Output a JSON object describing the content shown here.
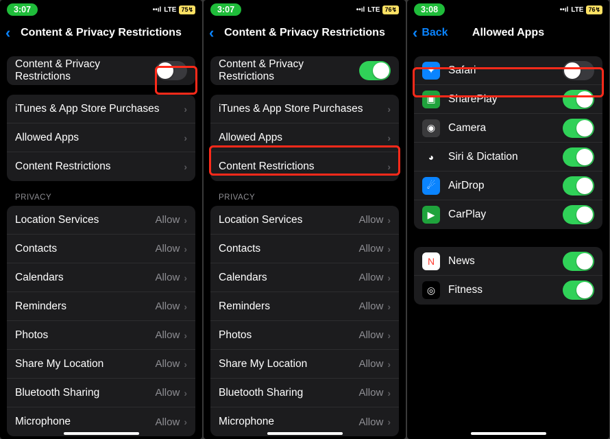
{
  "phones": [
    {
      "time": "3:07",
      "signal": "••ıl",
      "network": "LTE",
      "battery": "75",
      "title": "Content & Privacy Restrictions",
      "toggleRow": {
        "label": "Content & Privacy Restrictions",
        "on": false
      },
      "navRows": [
        {
          "label": "iTunes & App Store Purchases"
        },
        {
          "label": "Allowed Apps"
        },
        {
          "label": "Content Restrictions"
        }
      ],
      "privacyHeader": "PRIVACY",
      "privacyRows": [
        {
          "label": "Location Services",
          "value": "Allow"
        },
        {
          "label": "Contacts",
          "value": "Allow"
        },
        {
          "label": "Calendars",
          "value": "Allow"
        },
        {
          "label": "Reminders",
          "value": "Allow"
        },
        {
          "label": "Photos",
          "value": "Allow"
        },
        {
          "label": "Share My Location",
          "value": "Allow"
        },
        {
          "label": "Bluetooth Sharing",
          "value": "Allow"
        },
        {
          "label": "Microphone",
          "value": "Allow"
        }
      ]
    },
    {
      "time": "3:07",
      "signal": "••ıl",
      "network": "LTE",
      "battery": "76",
      "title": "Content & Privacy Restrictions",
      "toggleRow": {
        "label": "Content & Privacy Restrictions",
        "on": true
      },
      "navRows": [
        {
          "label": "iTunes & App Store Purchases"
        },
        {
          "label": "Allowed Apps"
        },
        {
          "label": "Content Restrictions"
        }
      ],
      "privacyHeader": "PRIVACY",
      "privacyRows": [
        {
          "label": "Location Services",
          "value": "Allow"
        },
        {
          "label": "Contacts",
          "value": "Allow"
        },
        {
          "label": "Calendars",
          "value": "Allow"
        },
        {
          "label": "Reminders",
          "value": "Allow"
        },
        {
          "label": "Photos",
          "value": "Allow"
        },
        {
          "label": "Share My Location",
          "value": "Allow"
        },
        {
          "label": "Bluetooth Sharing",
          "value": "Allow"
        },
        {
          "label": "Microphone",
          "value": "Allow"
        }
      ]
    },
    {
      "time": "3:08",
      "signal": "••ıl",
      "network": "LTE",
      "battery": "76",
      "back": "Back",
      "title": "Allowed Apps",
      "apps": [
        {
          "label": "Safari",
          "on": false,
          "iconColor": "#0a84ff",
          "glyph": "✦"
        },
        {
          "label": "SharePlay",
          "on": true,
          "iconColor": "#1fa33c",
          "glyph": "▣"
        },
        {
          "label": "Camera",
          "on": true,
          "iconColor": "#3a3a3c",
          "glyph": "◉"
        },
        {
          "label": "Siri & Dictation",
          "on": true,
          "iconColor": "#1c1c1e",
          "glyph": "◕"
        },
        {
          "label": "AirDrop",
          "on": true,
          "iconColor": "#0a84ff",
          "glyph": "☄"
        },
        {
          "label": "CarPlay",
          "on": true,
          "iconColor": "#1fa33c",
          "glyph": "▶"
        }
      ],
      "apps2": [
        {
          "label": "News",
          "on": true,
          "iconColor": "#ffffff",
          "glyph": "N"
        },
        {
          "label": "Fitness",
          "on": true,
          "iconColor": "#000000",
          "glyph": "◎"
        }
      ]
    }
  ]
}
